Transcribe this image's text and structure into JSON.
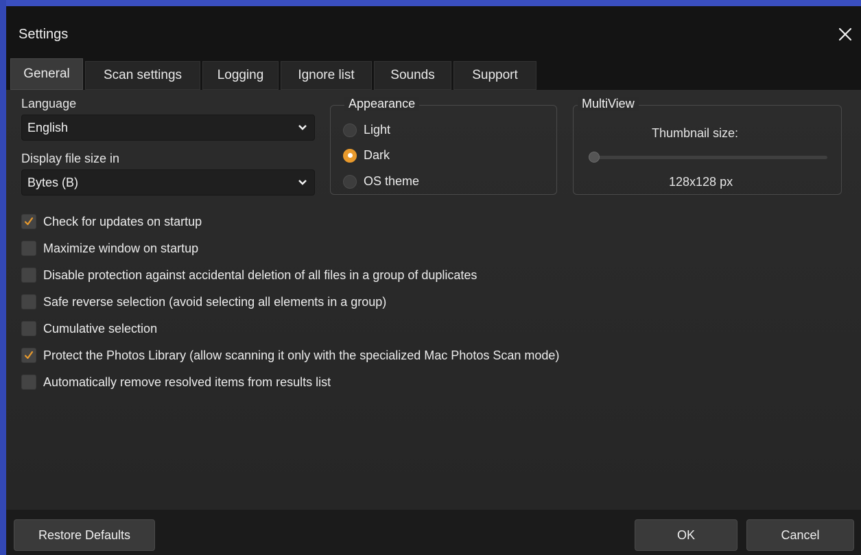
{
  "window": {
    "title": "Settings"
  },
  "tabs": [
    {
      "label": "General",
      "active": true
    },
    {
      "label": "Scan settings"
    },
    {
      "label": "Logging"
    },
    {
      "label": "Ignore list"
    },
    {
      "label": "Sounds"
    },
    {
      "label": "Support"
    }
  ],
  "general": {
    "language": {
      "label": "Language",
      "value": "English"
    },
    "file_size": {
      "label": "Display file size in",
      "value": "Bytes (B)"
    },
    "appearance": {
      "title": "Appearance",
      "options": [
        {
          "label": "Light",
          "selected": false
        },
        {
          "label": "Dark",
          "selected": true
        },
        {
          "label": "OS theme",
          "selected": false
        }
      ]
    },
    "multiview": {
      "title": "MultiView",
      "thumbnail_label": "Thumbnail size:",
      "thumbnail_value": "128x128 px",
      "slider_fraction": 0.0
    },
    "checkboxes": [
      {
        "label": "Check for updates on startup",
        "checked": true
      },
      {
        "label": "Maximize window on startup",
        "checked": false
      },
      {
        "label": "Disable protection against accidental deletion of all files in a group of duplicates",
        "checked": false
      },
      {
        "label": "Safe reverse selection (avoid selecting all elements in a group)",
        "checked": false
      },
      {
        "label": "Cumulative selection",
        "checked": false
      },
      {
        "label": "Protect the Photos Library (allow scanning it only with the specialized Mac Photos Scan mode)",
        "checked": true
      },
      {
        "label": "Automatically remove resolved items from results list",
        "checked": false
      }
    ]
  },
  "footer": {
    "restore_label": "Restore Defaults",
    "ok_label": "OK",
    "cancel_label": "Cancel"
  },
  "colors": {
    "accent": "#e99a2c",
    "background": "#2b2b2b",
    "titlebar": "#141414"
  }
}
